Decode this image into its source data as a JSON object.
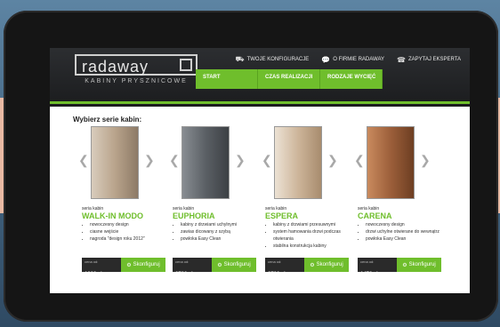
{
  "brand": {
    "logo_text": "radaway",
    "sub_text": "KABINY PRYSZNICOWE"
  },
  "top_links": [
    {
      "label": "TWOJE KONFIGURACJE",
      "icon": "cart-icon"
    },
    {
      "label": "O FIRMIE RADAWAY",
      "icon": "chat-icon"
    },
    {
      "label": "ZAPYTAJ EKSPERTA",
      "icon": "phone-icon"
    }
  ],
  "nav": [
    "START",
    "CZAS REALIZACJI",
    "RODZAJE WYCIĘĆ"
  ],
  "heading": "Wybierz serie kabin:",
  "products": [
    {
      "seria": "seria kabin",
      "name": "WALK-IN MODO",
      "features": [
        "nowoczesny design",
        "ciasne wejście",
        "nagroda \"design roku 2012\""
      ],
      "price_label": "cena od:",
      "price": "1989 zł",
      "button": "Skonfiguruj",
      "img_color": "#b9a48c"
    },
    {
      "seria": "seria kabin",
      "name": "EUPHORIA",
      "features": [
        "kabiny z drzwiami uchylnymi",
        "zawias dicowany z szybą",
        "powłoka Easy Clean"
      ],
      "price_label": "cena od:",
      "price": "2730 zł",
      "button": "Skonfiguruj",
      "img_color": "#5b6065"
    },
    {
      "seria": "seria kabin",
      "name": "ESPERA",
      "features": [
        "kabiny z drzwiami przesuwnymi",
        "system hamowania drzwi podczas otwierania",
        "stabilna konstrukcja kabiny"
      ],
      "price_label": "cena od:",
      "price": "2782 zł",
      "button": "Skonfiguruj",
      "img_color": "#cdb59a"
    },
    {
      "seria": "seria kabin",
      "name": "CARENA",
      "features": [
        "nowoczesny design",
        "drzwi uchylne otwierane do wewnątrz",
        "powłoka Easy Clean"
      ],
      "price_label": "cena od:",
      "price": "1472 zł",
      "button": "Skonfiguruj",
      "img_color": "#9c5f3a"
    }
  ]
}
